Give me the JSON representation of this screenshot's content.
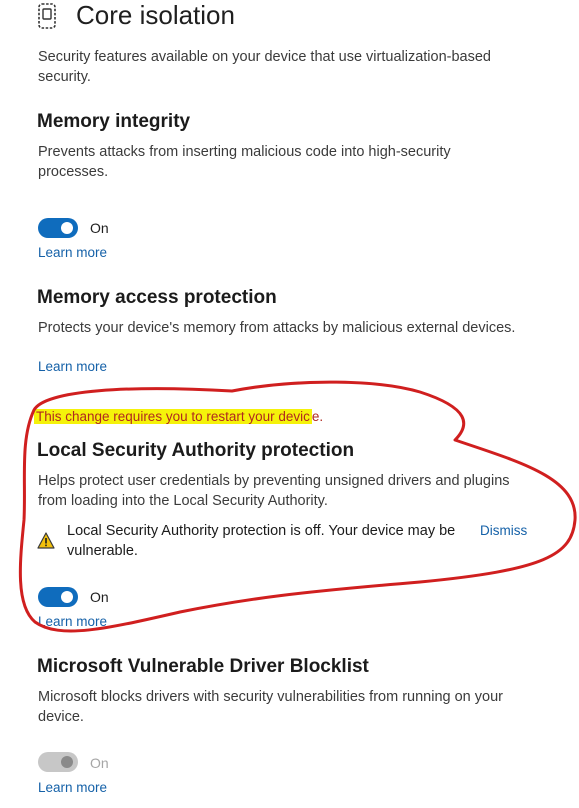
{
  "header": {
    "title": "Core isolation",
    "icon": "chip-shield-icon",
    "description": "Security features available on your device that use virtualization-based security."
  },
  "memory_integrity": {
    "title": "Memory integrity",
    "description": "Prevents attacks from inserting malicious code into high-security processes.",
    "toggle_label": "On",
    "learn_more": "Learn more"
  },
  "memory_access": {
    "title": "Memory access protection",
    "description": "Protects your device's memory from attacks by malicious external devices.",
    "learn_more": "Learn more"
  },
  "restart_notice": {
    "highlighted": "This change requires you to restart your devic",
    "tail": "e."
  },
  "lsa": {
    "title": "Local Security Authority protection",
    "description": "Helps protect user credentials by preventing unsigned drivers and plugins from loading into the Local Security Authority.",
    "warning": "Local Security Authority protection is off. Your device may be vulnerable.",
    "dismiss": "Dismiss",
    "toggle_label": "On",
    "learn_more": "Learn more"
  },
  "driver_blocklist": {
    "title": "Microsoft Vulnerable Driver Blocklist",
    "description": "Microsoft blocks drivers with security vulnerabilities from running on your device.",
    "toggle_label": "On",
    "learn_more": "Learn more"
  },
  "colors": {
    "accent": "#0f6cbd",
    "link": "#1561a8",
    "annotation": "#d01f1f",
    "highlight": "#f5f20a"
  }
}
